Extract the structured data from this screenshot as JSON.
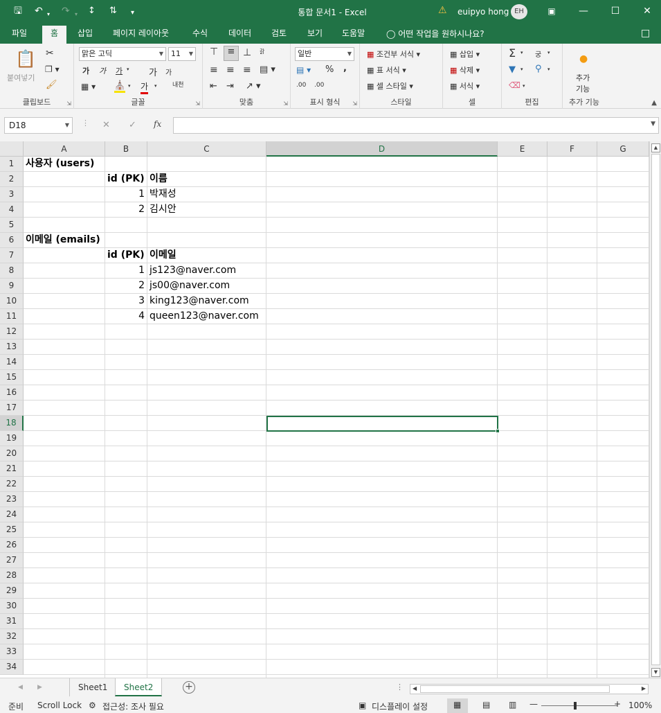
{
  "titlebar": {
    "title": "통합 문서1  -  Excel",
    "user": "euipyo hong",
    "avatar": "EH",
    "icons": [
      "save-icon",
      "undo-icon",
      "redo-icon",
      "sort-asc-icon",
      "sort-desc-icon",
      "customize-icon",
      "warning-icon",
      "ribbon-display-icon",
      "minimize-icon",
      "maximize-icon",
      "close-icon"
    ]
  },
  "tabs": [
    "파일",
    "홈",
    "삽입",
    "페이지 레이아웃",
    "수식",
    "데이터",
    "검토",
    "보기",
    "도움말"
  ],
  "active_tab": "홈",
  "tell_me": "어떤 작업을 원하시나요?",
  "ribbon": {
    "clipboard": {
      "label": "클립보드",
      "paste": "붙여넣기"
    },
    "font": {
      "label": "글꼴",
      "font_name": "맑은 고딕",
      "font_size": "11",
      "bold": "가",
      "italic": "가",
      "underline": "가",
      "grow": "가",
      "shrink": "가",
      "font_color": "가",
      "phonetic": "내천"
    },
    "alignment": {
      "label": "맞춤",
      "wrap": "갉"
    },
    "number": {
      "label": "표시 형식",
      "format": "일반",
      "percent": "%",
      "comma": ",",
      "inc_decimal": ".00",
      "dec_decimal": ".00"
    },
    "styles": {
      "label": "스타일",
      "conditional": "조건부 서식",
      "table": "표 서식",
      "cell_styles": "셀 스타일"
    },
    "cells": {
      "label": "셀",
      "insert": "삽입",
      "delete": "삭제",
      "format": "서식"
    },
    "editing": {
      "label": "편집",
      "sort": "궁"
    },
    "addins": {
      "label": "추가 기능",
      "button_line1": "추가",
      "button_line2": "기능"
    }
  },
  "formula_bar": {
    "name_box": "D18",
    "fx": "fx",
    "formula": ""
  },
  "columns": [
    "A",
    "B",
    "C",
    "D",
    "E",
    "F",
    "G"
  ],
  "selected_column": "D",
  "rows": [
    "1",
    "2",
    "3",
    "4",
    "5",
    "6",
    "7",
    "8",
    "9",
    "10",
    "11",
    "12",
    "13",
    "14",
    "15",
    "16",
    "17",
    "18",
    "19",
    "20",
    "21",
    "22",
    "23",
    "24",
    "25",
    "26",
    "27",
    "28",
    "29",
    "30",
    "31",
    "32",
    "33",
    "34"
  ],
  "selected_row": "18",
  "cells": {
    "A1": "사용자 (users)",
    "B2": "id (PK)",
    "C2": "이름",
    "B3": "1",
    "C3": "박재성",
    "B4": "2",
    "C4": "김시안",
    "A6": "이메일 (emails)",
    "B7": "id (PK)",
    "C7": "이메일",
    "B8": "1",
    "C8": "js123@naver.com",
    "B9": "2",
    "C9": "js00@naver.com",
    "B10": "3",
    "C10": "king123@naver.com",
    "B11": "4",
    "C11": "queen123@naver.com"
  },
  "sheets": [
    "Sheet1",
    "Sheet2"
  ],
  "active_sheet": "Sheet2",
  "status": {
    "ready": "준비",
    "scroll_lock": "Scroll Lock",
    "accessibility": "접근성: 조사 필요",
    "display": "디스플레이 설정",
    "zoom": "100%"
  },
  "colors": {
    "accent": "#217346",
    "header_bg": "#e6e6e6",
    "ribbon_bg": "#f3f3f3"
  }
}
